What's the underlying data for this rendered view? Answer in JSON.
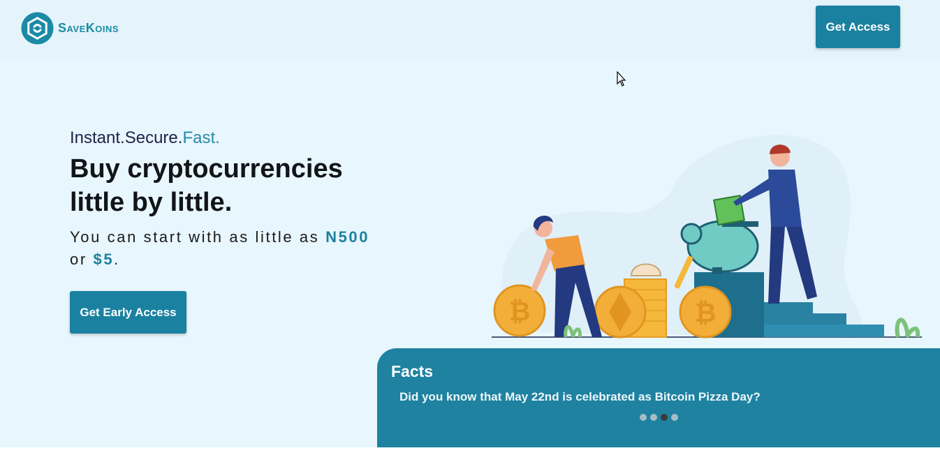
{
  "brand": {
    "name": "SaveKoins",
    "logo_icon": "hexagon-eye-logo",
    "color": "#1b8aa5"
  },
  "header": {
    "cta_label": "Get Access"
  },
  "hero": {
    "tagline_part1": "Instant.Secure.",
    "tagline_part2": "Fast.",
    "headline": "Buy cryptocurrencies little by little.",
    "sub_prefix": "You can start with as little as ",
    "amount_naira": "N500",
    "sub_or": " or ",
    "amount_dollar": "$5",
    "sub_suffix": ".",
    "cta_label": "Get Early Access"
  },
  "facts": {
    "title": "Facts",
    "text": "Did you know that May 22nd is celebrated as Bitcoin Pizza Day?",
    "dots": [
      {
        "active": false
      },
      {
        "active": false
      },
      {
        "active": true
      },
      {
        "active": false
      }
    ]
  },
  "colors": {
    "accent": "#1b81a0",
    "background": "#e8f6fd",
    "coin": "#f5b83a"
  }
}
